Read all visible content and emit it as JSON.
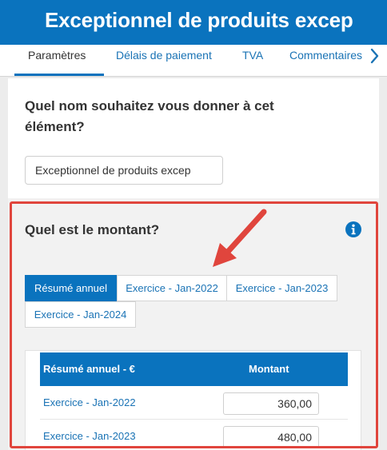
{
  "header": {
    "title": "Exceptionnel de produits excep"
  },
  "tabs": [
    {
      "label": "Paramètres"
    },
    {
      "label": "Délais de paiement"
    },
    {
      "label": "TVA"
    },
    {
      "label": "Commentaires"
    }
  ],
  "form": {
    "name_question": "Quel nom souhaitez vous donner à cet élément?",
    "name_value": "Exceptionnel de produits excep",
    "amount_question": "Quel est le montant?"
  },
  "period_tabs": [
    {
      "label": "Résumé annuel"
    },
    {
      "label": "Exercice - Jan-2022"
    },
    {
      "label": "Exercice - Jan-2023"
    },
    {
      "label": "Exercice - Jan-2024"
    }
  ],
  "table": {
    "headers": [
      "Résumé annuel - €",
      "Montant"
    ],
    "rows": [
      {
        "label": "Exercice - Jan-2022",
        "value": "360,00"
      },
      {
        "label": "Exercice - Jan-2023",
        "value": "480,00"
      }
    ]
  },
  "icons": {
    "info": "info-circle-icon",
    "next_tab": "chevron-right-icon",
    "annotation": "arrow-annotation-icon"
  },
  "colors": {
    "brand_blue": "#0a73be",
    "link_blue": "#1a73b5",
    "annotation_red": "#e0453d"
  }
}
